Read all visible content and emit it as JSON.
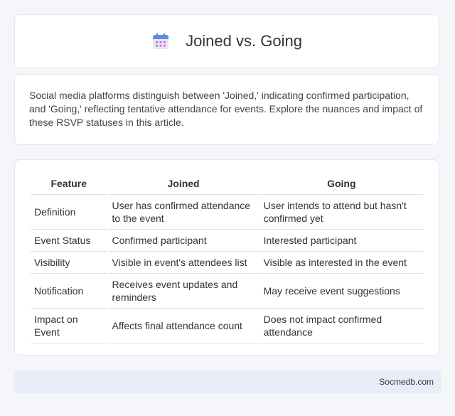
{
  "header": {
    "title": "Joined vs. Going",
    "icon": "calendar-icon"
  },
  "intro": {
    "text": "Social media platforms distinguish between 'Joined,' indicating confirmed participation, and 'Going,' reflecting tentative attendance for events. Explore the nuances and impact of these RSVP statuses in this article."
  },
  "table": {
    "headers": [
      "Feature",
      "Joined",
      "Going"
    ],
    "rows": [
      [
        "Definition",
        "User has confirmed attendance to the event",
        "User intends to attend but hasn't confirmed yet"
      ],
      [
        "Event Status",
        "Confirmed participant",
        "Interested participant"
      ],
      [
        "Visibility",
        "Visible in event's attendees list",
        "Visible as interested in the event"
      ],
      [
        "Notification",
        "Receives event updates and reminders",
        "May receive event suggestions"
      ],
      [
        "Impact on Event",
        "Affects final attendance count",
        "Does not impact confirmed attendance"
      ]
    ]
  },
  "footer": {
    "site": "Socmedb.com"
  }
}
